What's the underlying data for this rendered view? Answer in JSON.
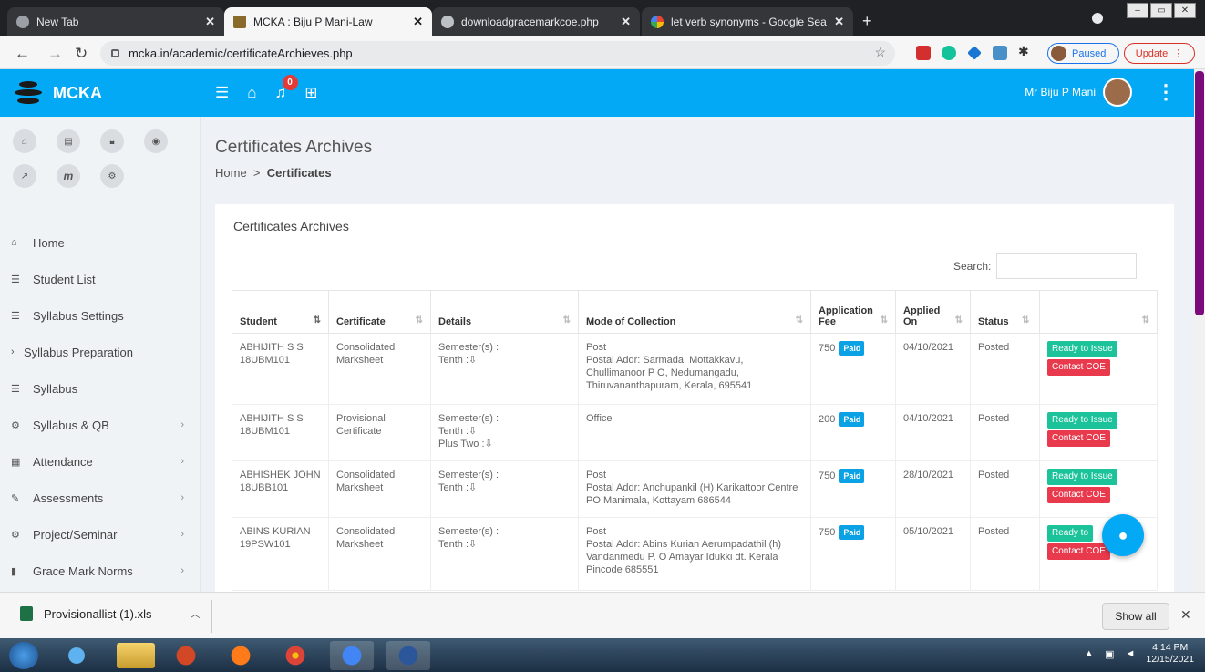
{
  "browser": {
    "tabs": [
      {
        "title": "New Tab",
        "favicon": "chrome-icon"
      },
      {
        "title": "MCKA : Biju P Mani-Law",
        "favicon": "mcka-logo-icon"
      },
      {
        "title": "downloadgracemarkcoe.php",
        "favicon": "globe-icon"
      },
      {
        "title": "let verb synonyms - Google Searc",
        "favicon": "google-icon"
      }
    ],
    "url": "mcka.in/academic/certificateArchieves.php",
    "profile_status": "Paused",
    "update_label": "Update"
  },
  "app": {
    "brand": "MCKA",
    "notification_count": "0",
    "user_name": "Mr Biju P Mani",
    "accent_color": "#03a9f4"
  },
  "sidebar": {
    "quick_icons": [
      "home-icon",
      "id-card-icon",
      "lock-icon",
      "eye-icon",
      "external-link-icon",
      "m-logo-icon",
      "gear-icon"
    ],
    "items": [
      {
        "label": "Home",
        "icon": "home-icon",
        "has_children": false
      },
      {
        "label": "Student List",
        "icon": "list-icon",
        "has_children": false
      },
      {
        "label": "Syllabus Settings",
        "icon": "list-icon",
        "has_children": false
      },
      {
        "label": "Syllabus Preparation",
        "icon": "chevron-right-icon",
        "has_children": false
      },
      {
        "label": "Syllabus",
        "icon": "list-icon",
        "has_children": false
      },
      {
        "label": "Syllabus & QB",
        "icon": "gears-icon",
        "has_children": true
      },
      {
        "label": "Attendance",
        "icon": "calendar-icon",
        "has_children": true
      },
      {
        "label": "Assessments",
        "icon": "pencil-icon",
        "has_children": true
      },
      {
        "label": "Project/Seminar",
        "icon": "gears-icon",
        "has_children": true
      },
      {
        "label": "Grace Mark Norms",
        "icon": "book-icon",
        "has_children": true
      }
    ]
  },
  "page": {
    "title": "Certificates Archives",
    "breadcrumb_home": "Home",
    "breadcrumb_sep": ">",
    "breadcrumb_current": "Certificates",
    "card_title": "Certificates Archives",
    "search_label": "Search:",
    "search_value": ""
  },
  "table": {
    "headers": [
      "Student",
      "Certificate",
      "Details",
      "Mode of Collection",
      "Application Fee",
      "Applied On",
      "Status",
      ""
    ],
    "rows": [
      {
        "student_name": "ABHIJITH S S",
        "student_id": "18UBM101",
        "certificate": "Consolidated Marksheet",
        "details": [
          "Semester(s) :",
          "Tenth :"
        ],
        "mode": "Post",
        "address": "Postal Addr: Sarmada, Mottakkavu, Chullimanoor P O, Nedumangadu, Thiruvananthapuram, Kerala, 695541",
        "fee": "750",
        "fee_status": "Paid",
        "applied_on": "04/10/2021",
        "status": "Posted",
        "action_primary": "Ready to Issue",
        "action_secondary": "Contact COE"
      },
      {
        "student_name": "ABHIJITH S S",
        "student_id": "18UBM101",
        "certificate": "Provisional Certificate",
        "details": [
          "Semester(s) :",
          "Tenth :",
          "Plus Two :"
        ],
        "mode": "Office",
        "address": "",
        "fee": "200",
        "fee_status": "Paid",
        "applied_on": "04/10/2021",
        "status": "Posted",
        "action_primary": "Ready to Issue",
        "action_secondary": "Contact COE"
      },
      {
        "student_name": "ABHISHEK JOHN",
        "student_id": "18UBB101",
        "certificate": "Consolidated Marksheet",
        "details": [
          "Semester(s) :",
          "Tenth :"
        ],
        "mode": "Post",
        "address": "Postal Addr: Anchupankil (H) Karikattoor Centre PO Manimala, Kottayam 686544",
        "fee": "750",
        "fee_status": "Paid",
        "applied_on": "28/10/2021",
        "status": "Posted",
        "action_primary": "Ready to Issue",
        "action_secondary": "Contact COE"
      },
      {
        "student_name": "ABINS KURIAN",
        "student_id": "19PSW101",
        "certificate": "Consolidated Marksheet",
        "details": [
          "Semester(s) :",
          "Tenth :"
        ],
        "mode": "Post",
        "address": "Postal Addr: Abins Kurian Aerumpadathil (h) Vandanmedu P. O Amayar Idukki dt. Kerala Pincode 685551",
        "fee": "750",
        "fee_status": "Paid",
        "applied_on": "05/10/2021",
        "status": "Posted",
        "action_primary": "Ready to",
        "action_secondary": "Contact COE"
      }
    ]
  },
  "downloads": {
    "file_name": "Provisionallist (1).xls",
    "show_all": "Show all"
  },
  "taskbar": {
    "time": "4:14 PM",
    "date": "12/15/2021"
  }
}
